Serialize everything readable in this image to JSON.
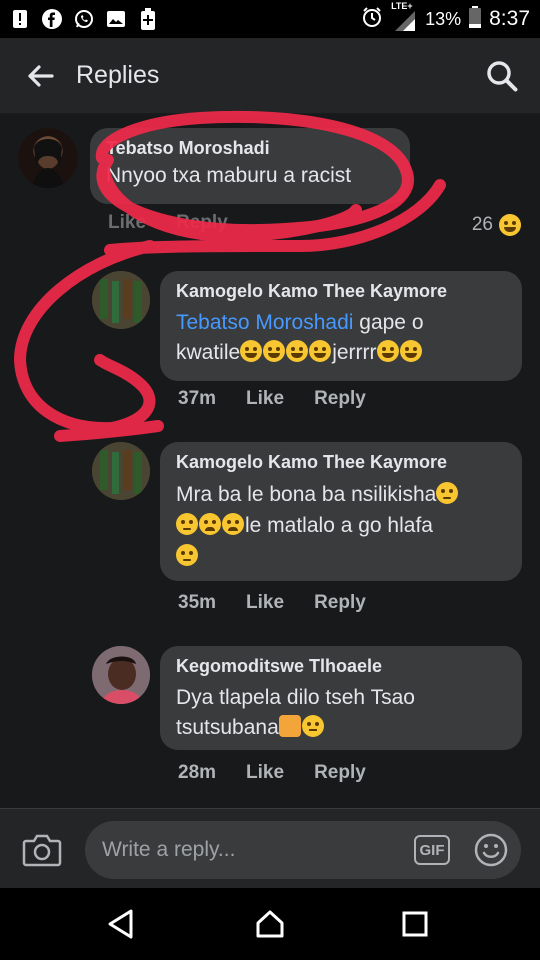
{
  "status": {
    "battery": "13%",
    "time": "8:37",
    "network": "LTE+"
  },
  "header": {
    "title": "Replies"
  },
  "comments": [
    {
      "author": "Tebatso Moroshadi",
      "text": "Nnyoo txa maburu a racist",
      "reaction_count": "26",
      "like": "Like",
      "reply": "Reply"
    },
    {
      "author": "Kamogelo Kamo Thee Kaymore",
      "mention": "Tebatso Moroshadi",
      "text_a": " gape o",
      "text_b": "kwatile",
      "text_c": "jerrrr",
      "time": "37m",
      "like": "Like",
      "reply": "Reply"
    },
    {
      "author": "Kamogelo Kamo Thee Kaymore",
      "text_a": "Mra ba le bona ba nsilikisha",
      "text_b": "le matlalo a go hlafa",
      "time": "35m",
      "like": "Like",
      "reply": "Reply"
    },
    {
      "author": "Kegomoditswe Tlhoaele",
      "text_a": "Dya tlapela dilo tseh Tsao",
      "text_b": "tsutsubana",
      "time": "28m",
      "like": "Like",
      "reply": "Reply"
    }
  ],
  "composer": {
    "placeholder": "Write a reply...",
    "gif_label": "GIF"
  }
}
